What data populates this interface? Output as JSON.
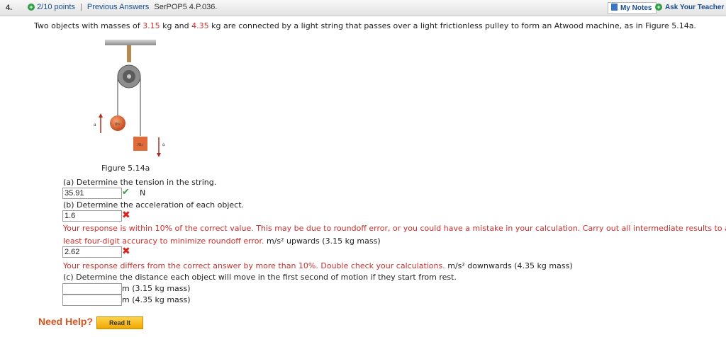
{
  "header": {
    "question_number": "4.",
    "points": "2/10 points",
    "separator": "|",
    "previous_answers": "Previous Answers",
    "problem_code": "SerPOP5 4.P.036.",
    "my_notes": "My Notes",
    "ask_teacher": "Ask Your Teacher",
    "plus_glyph": "+"
  },
  "prompt": {
    "part1": "Two objects with masses of ",
    "mass1": "3.15",
    "part2": " kg and ",
    "mass2": "4.35",
    "part3": " kg are connected by a light string that passes over a light frictionless pulley to form an Atwood machine, as in Figure 5.14a."
  },
  "figure": {
    "caption": "Figure 5.14a",
    "label_a": "a",
    "label_m1": "m₁",
    "label_m2": "m₂"
  },
  "part_a": {
    "question": "(a) Determine the tension in the string.",
    "answer": "35.91",
    "unit": "N",
    "status": "correct"
  },
  "part_b": {
    "question": "(b) Determine the acceleration of each object.",
    "answer1": "1.6",
    "feedback1_line1": "Your response is within 10% of the correct value. This may be due to roundoff error, or you could have a mistake in your calculation. Carry out all intermediate results to at",
    "feedback1_line2": "least four-digit accuracy to minimize roundoff error.",
    "unit1": "m/s² upwards (3.15 kg mass)",
    "answer2": "2.62",
    "feedback2": "Your response differs from the correct answer by more than 10%. Double check your calculations.",
    "unit2": "m/s² downwards (4.35 kg mass)"
  },
  "part_c": {
    "question": "(c) Determine the distance each object will move in the first second of motion if they start from rest.",
    "answer1": "",
    "unit1": "m (3.15 kg mass)",
    "answer2": "",
    "unit2": "m (4.35 kg mass)"
  },
  "help": {
    "need_help": "Need Help?",
    "read_it": "Read It"
  },
  "icons": {
    "correct": "check-icon",
    "incorrect": "x-icon"
  }
}
